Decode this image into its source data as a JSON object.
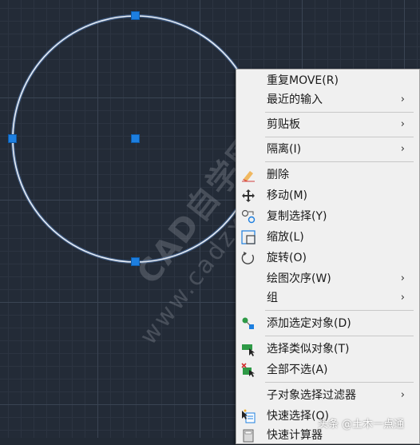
{
  "menu": {
    "items": [
      {
        "label": "重复MOVE(R)",
        "submenu": false,
        "icon": ""
      },
      {
        "label": "最近的输入",
        "submenu": true,
        "icon": ""
      },
      {
        "label": "剪贴板",
        "submenu": true,
        "icon": ""
      },
      {
        "label": "隔离(I)",
        "submenu": true,
        "icon": ""
      },
      {
        "label": "删除",
        "submenu": false,
        "icon": "eraser-icon"
      },
      {
        "label": "移动(M)",
        "submenu": false,
        "icon": "move-icon"
      },
      {
        "label": "复制选择(Y)",
        "submenu": false,
        "icon": "copy-icon"
      },
      {
        "label": "缩放(L)",
        "submenu": false,
        "icon": "scale-icon"
      },
      {
        "label": "旋转(O)",
        "submenu": false,
        "icon": "rotate-icon"
      },
      {
        "label": "绘图次序(W)",
        "submenu": true,
        "icon": ""
      },
      {
        "label": "组",
        "submenu": true,
        "icon": ""
      },
      {
        "label": "添加选定对象(D)",
        "submenu": false,
        "icon": "add-selected-icon"
      },
      {
        "label": "选择类似对象(T)",
        "submenu": false,
        "icon": "select-similar-icon"
      },
      {
        "label": "全部不选(A)",
        "submenu": false,
        "icon": "deselect-all-icon"
      },
      {
        "label": "子对象选择过滤器",
        "submenu": true,
        "icon": ""
      },
      {
        "label": "快速选择(Q)",
        "submenu": false,
        "icon": "quick-select-icon"
      },
      {
        "label": "快速计算器",
        "submenu": false,
        "icon": "calculator-icon"
      }
    ],
    "submenu_glyph": "›"
  },
  "watermark": {
    "line1": "CAD自学网",
    "line2": "www.cadzxw.com"
  },
  "credit": "头条 @土木一点通",
  "colors": {
    "canvas": "#232b37",
    "grip": "#1d7fe0",
    "circle": "#dfe6f0",
    "menu_bg": "#f0f0f0"
  }
}
